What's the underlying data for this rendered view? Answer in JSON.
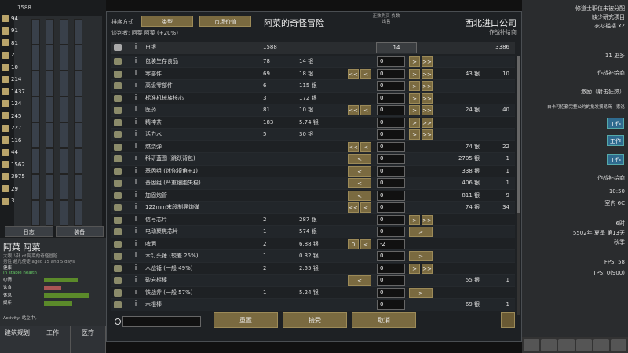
{
  "left": {
    "top_value": "1588",
    "resources": [
      "94",
      "91",
      "81",
      "2",
      "10",
      "214",
      "1437",
      "124",
      "245",
      "227",
      "116",
      "44",
      "1562",
      "3975",
      "29",
      "3"
    ],
    "tabs": [
      "日志",
      "装备"
    ],
    "pawn": {
      "name": "阿菜 阿菜",
      "subtitle": "大眼八卦 of 阿菜的奇怪冒险",
      "age": "男性 超凡使徒 aged 15 and 5 days",
      "health_label": "健康",
      "health_status": "In stable health",
      "needs": [
        {
          "label": "心情",
          "value": 0.6,
          "color": "#5b8a2a"
        },
        {
          "label": "饮食",
          "value": 0.3,
          "color": "#a55"
        },
        {
          "label": "休息",
          "value": 0.8,
          "color": "#5b8a2a"
        },
        {
          "label": "娱乐",
          "value": 0.5,
          "color": "#5b8a2a"
        }
      ],
      "activity": "Activity: 站立中。"
    },
    "bottom_tabs": [
      "建筑规划",
      "工作",
      "医疗"
    ]
  },
  "right": {
    "texts": [
      "修道士职位未被分配",
      "缺少研究项目",
      "衣衫褴褛 x2",
      "11 更多",
      "作战补给商",
      "激励（射击狂热）",
      "自卡可招勤完整公约的批发贸易商 - 索洛",
      "作战补给商",
      "10:50",
      "室内 6C",
      "6时",
      "5502年 夏季 第13天",
      "秋季",
      "FPS: 58",
      "TPS: 0(900)"
    ],
    "buttons": [
      "工作",
      "工作",
      "工作"
    ]
  },
  "dialog": {
    "sort_label": "排序方式",
    "sort_buttons": [
      "类型",
      "市场价值"
    ],
    "negotiator": "谈判者: 阿菜 阿菜 (+20%)",
    "title": "阿菜的奇怪冒险",
    "trader_name": "西北进口公司",
    "trader_kind": "作战补给商",
    "price_label": "正数购买 负数出售",
    "silver": {
      "name": "白银",
      "colony_qty": "1588",
      "value": "14",
      "trader_qty": "3386"
    },
    "rows": [
      {
        "name": "包装生存食品",
        "cq": "78",
        "cp": "14 银",
        "field": "0",
        "left": [],
        "right": [
          ">",
          ">>"
        ],
        "tp": "",
        "tq": ""
      },
      {
        "name": "零部件",
        "cq": "69",
        "cp": "18 银",
        "field": "0",
        "left": [
          "<<",
          "<"
        ],
        "right": [
          ">",
          ">>"
        ],
        "tp": "43 银",
        "tq": "10"
      },
      {
        "name": "高级零部件",
        "cq": "6",
        "cp": "115 银",
        "field": "0",
        "left": [],
        "right": [
          ">",
          ">>"
        ],
        "tp": "",
        "tq": ""
      },
      {
        "name": "标准机械族核心",
        "cq": "3",
        "cp": "172 银",
        "field": "0",
        "left": [],
        "right": [
          ">",
          ">>"
        ],
        "tp": "",
        "tq": ""
      },
      {
        "name": "医药",
        "cq": "81",
        "cp": "10 银",
        "field": "0",
        "left": [
          "<<",
          "<"
        ],
        "right": [
          ">",
          ">>"
        ],
        "tp": "24 银",
        "tq": "40"
      },
      {
        "name": "精神茶",
        "cq": "183",
        "cp": "5.74 银",
        "field": "0",
        "left": [],
        "right": [
          ">",
          ">>"
        ],
        "tp": "",
        "tq": ""
      },
      {
        "name": "活力水",
        "cq": "5",
        "cp": "30 银",
        "field": "0",
        "left": [],
        "right": [
          ">",
          ">>"
        ],
        "tp": "",
        "tq": ""
      },
      {
        "name": "燃烧弹",
        "cq": "",
        "cp": "",
        "field": "0",
        "left": [
          "<<",
          "<"
        ],
        "right": [],
        "tp": "74 银",
        "tq": "22"
      },
      {
        "name": "科研蓝图 (跳跃背包)",
        "cq": "",
        "cp": "",
        "field": "0",
        "left": [
          "<"
        ],
        "right": [],
        "tp": "2705 银",
        "tq": "1"
      },
      {
        "name": "基因组 (迷你犄角+1)",
        "cq": "",
        "cp": "",
        "field": "0",
        "left": [
          "<"
        ],
        "right": [],
        "tp": "338 银",
        "tq": "1"
      },
      {
        "name": "基因组 (严重细胞失稳)",
        "cq": "",
        "cp": "",
        "field": "0",
        "left": [
          "<"
        ],
        "right": [],
        "tp": "406 银",
        "tq": "1"
      },
      {
        "name": "加固炮管",
        "cq": "",
        "cp": "",
        "field": "0",
        "left": [
          "<"
        ],
        "right": [],
        "tp": "811 银",
        "tq": "9"
      },
      {
        "name": "122mm末段制导炮弹",
        "cq": "",
        "cp": "",
        "field": "0",
        "left": [
          "<<",
          "<"
        ],
        "right": [],
        "tp": "74 银",
        "tq": "34"
      },
      {
        "name": "信号芯片",
        "cq": "2",
        "cp": "287 银",
        "field": "0",
        "left": [],
        "right": [
          ">",
          ">>"
        ],
        "tp": "",
        "tq": ""
      },
      {
        "name": "电动聚焦芯片",
        "cq": "1",
        "cp": "574 银",
        "field": "0",
        "left": [],
        "right": [
          ">"
        ],
        "tp": "",
        "tq": ""
      },
      {
        "name": "啤酒",
        "cq": "2",
        "cp": "6.88 银",
        "field": "-2",
        "left": [
          "0",
          "<"
        ],
        "right": [],
        "tp": "",
        "tq": ""
      },
      {
        "name": "木钉头锤 (较差 25%)",
        "cq": "1",
        "cp": "0.32 银",
        "field": "0",
        "left": [],
        "right": [
          ">"
        ],
        "tp": "",
        "tq": ""
      },
      {
        "name": "木战锤 (一般 49%)",
        "cq": "2",
        "cp": "2.55 银",
        "field": "0",
        "left": [],
        "right": [
          ">",
          ">>"
        ],
        "tp": "",
        "tq": ""
      },
      {
        "name": "砂岩棍棒",
        "cq": "",
        "cp": "",
        "field": "0",
        "left": [
          "<"
        ],
        "right": [],
        "tp": "55 银",
        "tq": "1"
      },
      {
        "name": "铁战斧 (一般 57%)",
        "cq": "1",
        "cp": "5.24 银",
        "field": "0",
        "left": [],
        "right": [
          ">"
        ],
        "tp": "",
        "tq": ""
      },
      {
        "name": "木棍棒",
        "cq": "",
        "cp": "",
        "field": "0",
        "left": [],
        "right": [],
        "tp": "69 银",
        "tq": "1"
      }
    ],
    "search_placeholder": "",
    "footer": {
      "reset": "重置",
      "accept": "接受",
      "cancel": "取消"
    }
  }
}
